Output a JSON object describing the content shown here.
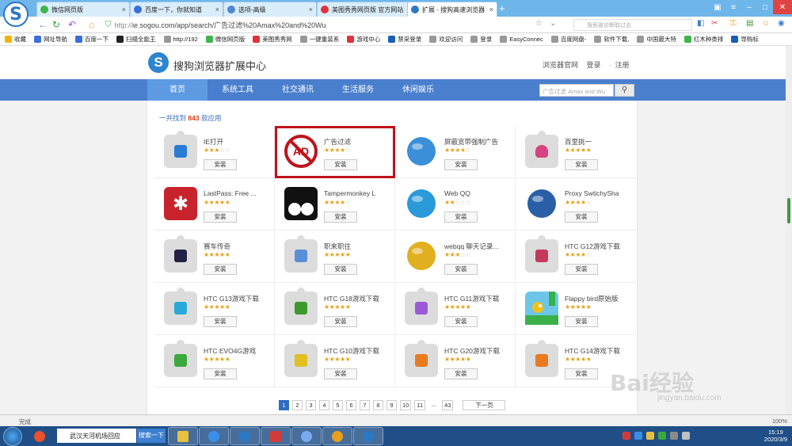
{
  "browser": {
    "tabs": [
      {
        "label": "微信网页版",
        "color": "#3db54a"
      },
      {
        "label": "百度一下，你就知道",
        "color": "#3b6fd8"
      },
      {
        "label": "选项-高级",
        "color": "#4f86d6"
      },
      {
        "label": "美图秀秀网页版 官方网站",
        "color": "#e0323b"
      },
      {
        "label": "扩展 - 搜狗高速浏览器",
        "color": "#2b78c5"
      }
    ],
    "url_prefix": "http://",
    "url_rest": "ie.sogou.com/app/search/广告过滤%20Amax%20and%20Wu",
    "search_placeholder": "搜索被诊断取过去",
    "bookmarks": [
      {
        "label": "收藏",
        "color": "#f0b400"
      },
      {
        "label": "网址导航",
        "color": "#3b6fd8"
      },
      {
        "label": "百度一下",
        "color": "#3b6fd8"
      },
      {
        "label": "扫描全能王",
        "color": "#222222"
      },
      {
        "label": "http://192",
        "color": "#999999"
      },
      {
        "label": "微信网页版",
        "color": "#3db54a"
      },
      {
        "label": "美图秀秀网",
        "color": "#e0323b"
      },
      {
        "label": "一键重装系",
        "color": "#999999"
      },
      {
        "label": "游戏中心",
        "color": "#e0323b"
      },
      {
        "label": "禁采登录",
        "color": "#1a5fb4"
      },
      {
        "label": "欢迎访问",
        "color": "#999999"
      },
      {
        "label": "登录",
        "color": "#999999"
      },
      {
        "label": "EasyConnec",
        "color": "#999999"
      },
      {
        "label": "百度网盘-",
        "color": "#999999"
      },
      {
        "label": "软件下载,",
        "color": "#999999"
      },
      {
        "label": "中国最大特",
        "color": "#999999"
      },
      {
        "label": "红木种类排",
        "color": "#3db54a"
      },
      {
        "label": "导购标",
        "color": "#1a5fb4"
      }
    ]
  },
  "site": {
    "title": "搜狗浏览器扩展中心",
    "logo_letter": "S",
    "links": [
      "浏览器官网",
      "登录",
      "注册"
    ],
    "nav": [
      "首页",
      "系统工具",
      "社交通讯",
      "生活服务",
      "休闲娱乐"
    ],
    "search_placeholder": "广告过滤 Amax and Wu",
    "found_prefix": "一共找到",
    "found_count": "843",
    "found_suffix": "款应用",
    "install_label": "安装"
  },
  "apps": [
    {
      "name": "IE打开",
      "stars": 3,
      "icon": "ie-icon",
      "color": "#2a7bd4"
    },
    {
      "name": "广告过滤",
      "stars": 4,
      "icon": "no-ad-icon",
      "color": "#c0121a",
      "highlight": true
    },
    {
      "name": "屏蔽宽带强制广告",
      "stars": 4,
      "icon": "globe-wall-icon",
      "color": "#3a8fd8"
    },
    {
      "name": "百里挑一",
      "stars": 5,
      "icon": "heart-icon",
      "color": "#d6427d"
    },
    {
      "name": "LastPass: Free ...",
      "stars": 5,
      "icon": "lastpass-icon",
      "color": "#c8232c"
    },
    {
      "name": "Tampermonkey L",
      "stars": 4,
      "icon": "tampermonkey-icon",
      "color": "#111111"
    },
    {
      "name": "Web QQ",
      "stars": 2,
      "icon": "qq-icon",
      "color": "#2a9ad8"
    },
    {
      "name": "Proxy SwtichySha",
      "stars": 4,
      "icon": "globe-icon",
      "color": "#2a5fa8"
    },
    {
      "name": "赛车传奇",
      "stars": 5,
      "icon": "racing-icon",
      "color": "#222244"
    },
    {
      "name": "职来职往",
      "stars": 5,
      "icon": "job-icon",
      "color": "#5a8fd8"
    },
    {
      "name": "webqq 聊天记录...",
      "stars": 3,
      "icon": "chat-icon",
      "color": "#e0b020"
    },
    {
      "name": "HTC G12游戏下载",
      "stars": 4,
      "icon": "htc-icon",
      "color": "#c43a5a"
    },
    {
      "name": "HTC G13游戏下载",
      "stars": 5,
      "icon": "htc-icon",
      "color": "#2aa8d8"
    },
    {
      "name": "HTC G18游戏下载",
      "stars": 5,
      "icon": "htc-icon",
      "color": "#3a9a2a"
    },
    {
      "name": "HTC G11游戏下载",
      "stars": 5,
      "icon": "htc-icon",
      "color": "#9a5ad8"
    },
    {
      "name": "Flappy bird原始版",
      "stars": 5,
      "icon": "flappy-bird-icon",
      "color": "#3ab04a"
    },
    {
      "name": "HTC EVO4G游戏",
      "stars": 5,
      "icon": "htc-icon",
      "color": "#3aa83a"
    },
    {
      "name": "HTC G10游戏下载",
      "stars": 5,
      "icon": "htc-icon",
      "color": "#e0c020"
    },
    {
      "name": "HTC G20游戏下载",
      "stars": 5,
      "icon": "htc-icon",
      "color": "#e87a20"
    },
    {
      "name": "HTC G14游戏下载",
      "stars": 5,
      "icon": "htc-icon",
      "color": "#e87a20"
    }
  ],
  "pager": {
    "pages": [
      "1",
      "2",
      "3",
      "4",
      "5",
      "6",
      "7",
      "8",
      "9",
      "10",
      "11",
      "...",
      "43"
    ],
    "current": "1",
    "next_label": "下一页"
  },
  "status": {
    "text": "完成",
    "zoom": "100%"
  },
  "taskbar": {
    "input_text": "武汉天河机场回应",
    "search_label": "搜索一下",
    "time": "15:19",
    "date": "2020/3/9"
  },
  "watermark": {
    "text": "Bai经验",
    "sub": "jingyan.baidu.com"
  }
}
